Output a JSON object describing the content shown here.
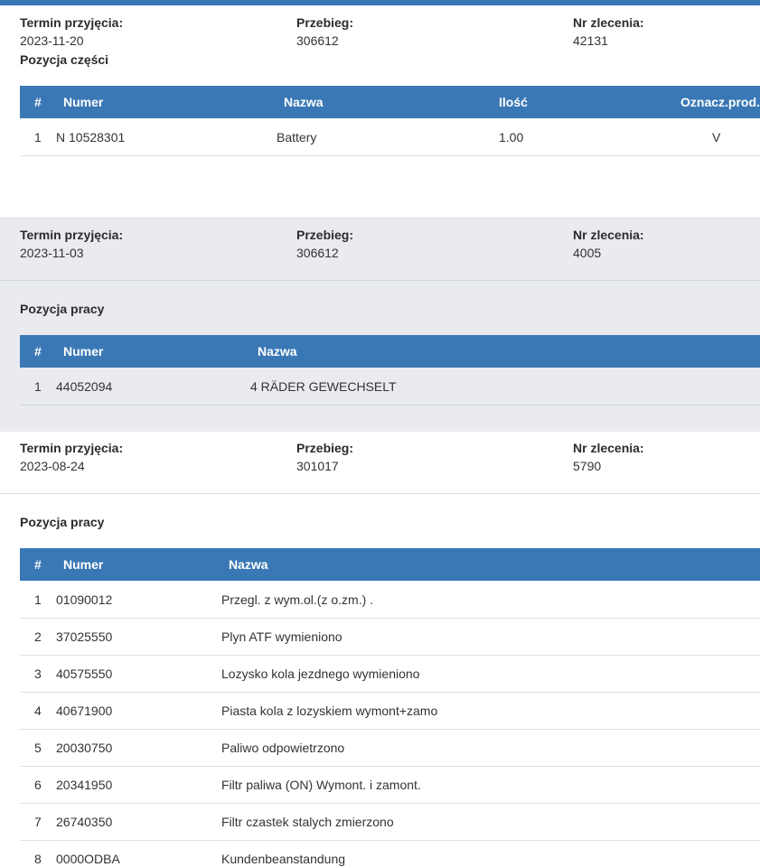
{
  "order1": {
    "date_label": "Termin przyjęcia:",
    "date": "2023-11-20",
    "mileage_label": "Przebieg:",
    "mileage": "306612",
    "order_label": "Nr zlecenia:",
    "order_no": "42131",
    "section_title": "Pozycja części",
    "columns": [
      "#",
      "Numer",
      "Nazwa",
      "Ilość",
      "Oznacz.prod."
    ],
    "rows": [
      {
        "idx": "1",
        "number": "N 10528301",
        "name": "Battery",
        "qty": "1.00",
        "mark": "V"
      }
    ]
  },
  "order2": {
    "date_label": "Termin przyjęcia:",
    "date": "2023-11-03",
    "mileage_label": "Przebieg:",
    "mileage": "306612",
    "order_label": "Nr zlecenia:",
    "order_no": "4005",
    "section_title": "Pozycja pracy",
    "columns": [
      "#",
      "Numer",
      "Nazwa"
    ],
    "rows": [
      {
        "idx": "1",
        "number": "44052094",
        "name": "4 RÄDER GEWECHSELT"
      }
    ]
  },
  "order3": {
    "date_label": "Termin przyjęcia:",
    "date": "2023-08-24",
    "mileage_label": "Przebieg:",
    "mileage": "301017",
    "order_label": "Nr zlecenia:",
    "order_no": "5790",
    "section_title": "Pozycja pracy",
    "columns": [
      "#",
      "Numer",
      "Nazwa"
    ],
    "rows": [
      {
        "idx": "1",
        "number": "01090012",
        "name": "Przegl. z wym.ol.(z o.zm.) ."
      },
      {
        "idx": "2",
        "number": "37025550",
        "name": "Plyn ATF wymieniono"
      },
      {
        "idx": "3",
        "number": "40575550",
        "name": "Lozysko kola jezdnego wymieniono"
      },
      {
        "idx": "4",
        "number": "40671900",
        "name": "Piasta kola z lozyskiem wymont+zamo"
      },
      {
        "idx": "5",
        "number": "20030750",
        "name": "Paliwo odpowietrzono"
      },
      {
        "idx": "6",
        "number": "20341950",
        "name": "Filtr paliwa (ON) Wymont. i zamont."
      },
      {
        "idx": "7",
        "number": "26740350",
        "name": "Filtr czastek stalych zmierzono"
      },
      {
        "idx": "8",
        "number": "0000ODBA",
        "name": "Kundenbeanstandung"
      }
    ]
  },
  "colors": {
    "accent": "#3a78b5",
    "section_bg": "#e9ebf0",
    "row_border": "#dde0e5"
  }
}
